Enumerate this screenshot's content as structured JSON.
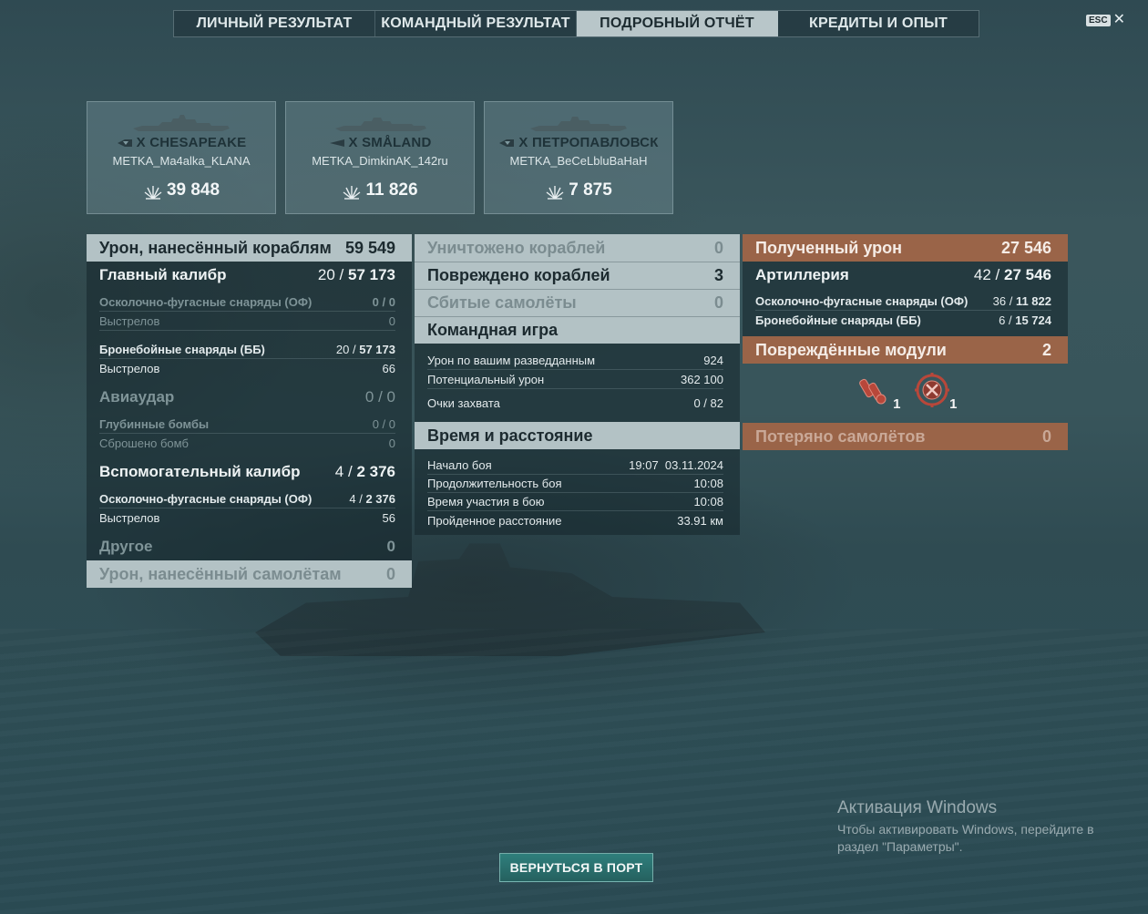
{
  "tabs": [
    {
      "label": "ЛИЧНЫЙ РЕЗУЛЬТАТ"
    },
    {
      "label": "КОМАНДНЫЙ РЕЗУЛЬТАТ"
    },
    {
      "label": "ПОДРОБНЫЙ ОТЧЁТ"
    },
    {
      "label": "КРЕДИТЫ И ОПЫТ"
    }
  ],
  "active_tab": "ПОДРОБНЫЙ ОТЧЁТ",
  "esc_label": "ESC",
  "close_glyph": "✕",
  "ships": [
    {
      "tier": "X",
      "name": "CHESAPEAKE",
      "player": "METKA_Ma4alka_KLANA",
      "damage": "39 848",
      "class_icon": "cruiser-icon"
    },
    {
      "tier": "X",
      "name": "SMÅLAND",
      "player": "METKA_DimkinAK_142ru",
      "damage": "11 826",
      "class_icon": "destroyer-icon"
    },
    {
      "tier": "X",
      "name": "ПЕТРОПАВЛОВСК",
      "player": "METKA_BeCeLbluBaHaH",
      "damage": "7 875",
      "class_icon": "cruiser-icon"
    }
  ],
  "left": {
    "ships_damage": {
      "label": "Урон, нанесённый кораблям",
      "value": "59 549"
    },
    "main_battery": {
      "label": "Главный калибр",
      "hits": "20",
      "sep": "/",
      "dmg": "57 173"
    },
    "mb_he": {
      "label": "Осколочно-фугасные снаряды (ОФ)",
      "hits": "0",
      "sep": "/",
      "dmg": "0"
    },
    "mb_he_shots": {
      "label": "Выстрелов",
      "value": "0"
    },
    "mb_ap": {
      "label": "Бронебойные снаряды (ББ)",
      "hits": "20",
      "sep": "/",
      "dmg": "57 173"
    },
    "mb_ap_shots": {
      "label": "Выстрелов",
      "value": "66"
    },
    "airstrike": {
      "label": "Авиаудар",
      "value": "0 / 0"
    },
    "depth_charges": {
      "label": "Глубинные бомбы",
      "value": "0 / 0"
    },
    "bombs_dropped": {
      "label": "Сброшено бомб",
      "value": "0"
    },
    "secondary": {
      "label": "Вспомогательный калибр",
      "hits": "4",
      "sep": "/",
      "dmg": "2 376"
    },
    "sec_he": {
      "label": "Осколочно-фугасные снаряды (ОФ)",
      "hits": "4",
      "sep": "/",
      "dmg": "2 376"
    },
    "sec_shots": {
      "label": "Выстрелов",
      "value": "56"
    },
    "other": {
      "label": "Другое",
      "value": "0"
    },
    "aircraft_damage": {
      "label": "Урон, нанесённый самолётам",
      "value": "0"
    }
  },
  "middle": {
    "destroyed": {
      "label": "Уничтожено кораблей",
      "value": "0"
    },
    "damaged": {
      "label": "Повреждено кораблей",
      "value": "3"
    },
    "planes_shot": {
      "label": "Сбитые самолёты",
      "value": "0"
    },
    "team_play": {
      "label": "Командная игра"
    },
    "spotting_damage": {
      "label": "Урон по вашим разведданным",
      "value": "924"
    },
    "potential_damage": {
      "label": "Потенциальный урон",
      "value": "362 100"
    },
    "capture_points": {
      "label": "Очки захвата",
      "value": "0 / 82"
    },
    "time_distance": {
      "label": "Время и расстояние"
    },
    "battle_start": {
      "label": "Начало боя",
      "value": "19:07  03.11.2024"
    },
    "battle_duration": {
      "label": "Продолжительность боя",
      "value": "10:08"
    },
    "time_in_battle": {
      "label": "Время участия в бою",
      "value": "10:08"
    },
    "distance": {
      "label": "Пройденное расстояние",
      "value": "33.91 км"
    }
  },
  "right": {
    "received": {
      "label": "Полученный урон",
      "value": "27 546"
    },
    "artillery": {
      "label": "Артиллерия",
      "hits": "42",
      "sep": "/",
      "dmg": "27 546"
    },
    "he": {
      "label": "Осколочно-фугасные снаряды (ОФ)",
      "hits": "36",
      "sep": "/",
      "dmg": "11 822"
    },
    "ap": {
      "label": "Бронебойные снаряды (ББ)",
      "hits": "6",
      "sep": "/",
      "dmg": "15 724"
    },
    "modules": {
      "label": "Повреждённые модули",
      "value": "2"
    },
    "module_items": [
      {
        "icon": "torpedo-tubes-icon",
        "count": "1"
      },
      {
        "icon": "steering-gear-icon",
        "count": "1"
      }
    ],
    "planes_lost": {
      "label": "Потеряно самолётов",
      "value": "0"
    }
  },
  "windows": {
    "title": "Активация Windows",
    "text": "Чтобы активировать Windows, перейдите в раздел \"Параметры\"."
  },
  "port_button": "ВЕРНУТЬСЯ В ПОРТ",
  "colors": {
    "light_header": "#b3c2c5",
    "orange_header": "#9a6448",
    "button": "#2f7f7c"
  }
}
